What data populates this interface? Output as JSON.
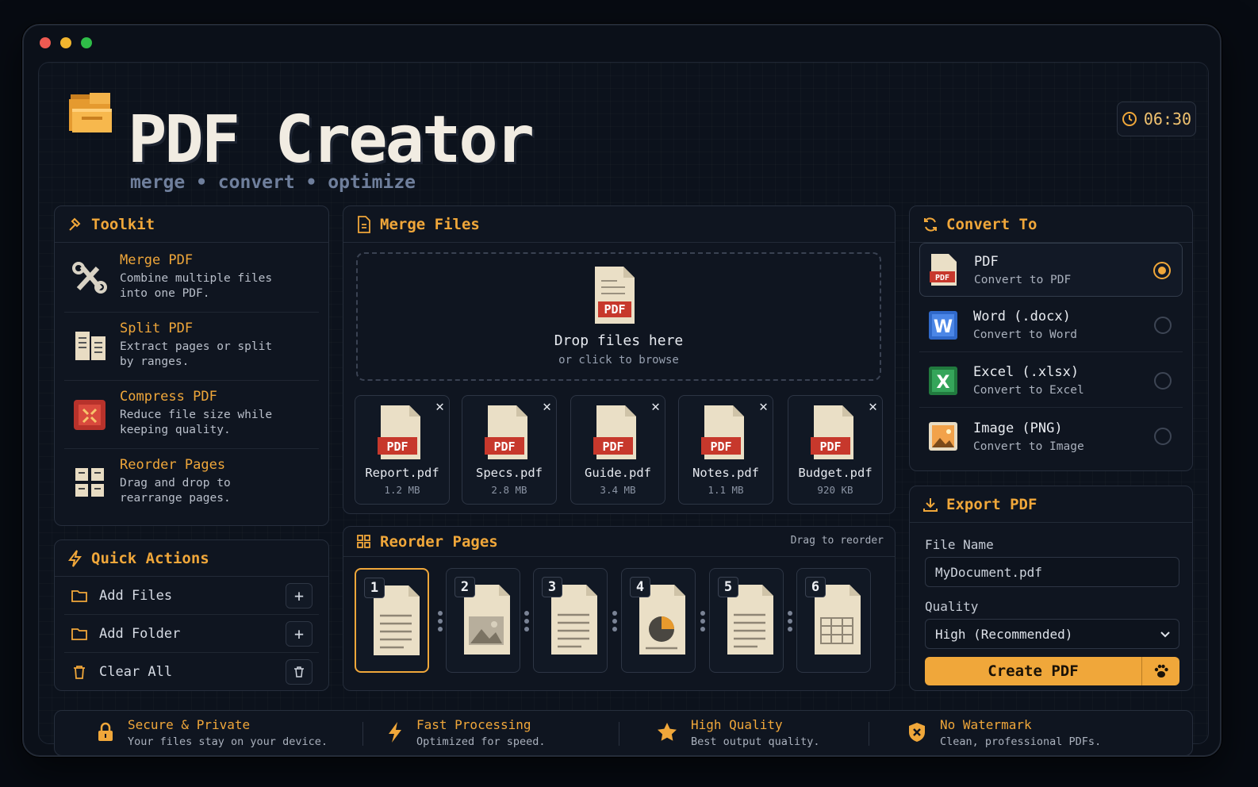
{
  "app": {
    "title": "PDF Creator",
    "subtitle": "merge • convert • optimize",
    "time": "06:30"
  },
  "colors": {
    "accent": "#f0a73a",
    "background": "#0b1019",
    "panel": "#0f1520"
  },
  "toolkit": {
    "title": "Toolkit",
    "items": [
      {
        "title": "Merge PDF",
        "desc": "Combine multiple files into one PDF.",
        "icon": "tools-icon"
      },
      {
        "title": "Split PDF",
        "desc": "Extract pages or split by ranges.",
        "icon": "split-document-icon"
      },
      {
        "title": "Compress PDF",
        "desc": "Reduce file size while keeping quality.",
        "icon": "compress-icon"
      },
      {
        "title": "Reorder Pages",
        "desc": "Drag and drop to rearrange pages.",
        "icon": "grid-pages-icon"
      }
    ]
  },
  "quick_actions": {
    "title": "Quick Actions",
    "items": [
      {
        "label": "Add Files",
        "icon": "folder-icon",
        "action": "plus-icon"
      },
      {
        "label": "Add Folder",
        "icon": "folder-icon",
        "action": "plus-icon"
      },
      {
        "label": "Clear All",
        "icon": "trash-icon",
        "action": "trash-icon"
      }
    ]
  },
  "merge": {
    "title": "Merge Files",
    "drop_title": "Drop files here",
    "drop_sub": "or click to browse",
    "pdf_badge": "PDF",
    "files": [
      {
        "name": "Report.pdf",
        "size": "1.2 MB"
      },
      {
        "name": "Specs.pdf",
        "size": "2.8 MB"
      },
      {
        "name": "Guide.pdf",
        "size": "3.4 MB"
      },
      {
        "name": "Notes.pdf",
        "size": "1.1 MB"
      },
      {
        "name": "Budget.pdf",
        "size": "920 KB"
      }
    ]
  },
  "reorder": {
    "title": "Reorder Pages",
    "hint": "Drag to reorder",
    "pages": [
      {
        "num": "1",
        "kind": "text"
      },
      {
        "num": "2",
        "kind": "image"
      },
      {
        "num": "3",
        "kind": "text"
      },
      {
        "num": "4",
        "kind": "chart"
      },
      {
        "num": "5",
        "kind": "text"
      },
      {
        "num": "6",
        "kind": "table"
      }
    ]
  },
  "convert": {
    "title": "Convert To",
    "options": [
      {
        "title": "PDF",
        "sub": "Convert to PDF",
        "selected": true,
        "icon": "pdf-file-icon",
        "badge": "PDF"
      },
      {
        "title": "Word (.docx)",
        "sub": "Convert to Word",
        "selected": false,
        "icon": "word-icon",
        "badge": "W"
      },
      {
        "title": "Excel (.xlsx)",
        "sub": "Convert to Excel",
        "selected": false,
        "icon": "excel-icon",
        "badge": "X"
      },
      {
        "title": "Image (PNG)",
        "sub": "Convert to Image",
        "selected": false,
        "icon": "image-icon"
      }
    ]
  },
  "export": {
    "title": "Export PDF",
    "file_name_label": "File Name",
    "file_name_value": "MyDocument.pdf",
    "quality_label": "Quality",
    "quality_value": "High (Recommended)",
    "create_label": "Create PDF"
  },
  "features": [
    {
      "title": "Secure & Private",
      "desc": "Your files stay on your device.",
      "icon": "lock-icon"
    },
    {
      "title": "Fast Processing",
      "desc": "Optimized for speed.",
      "icon": "lightning-icon"
    },
    {
      "title": "High Quality",
      "desc": "Best output quality.",
      "icon": "star-icon"
    },
    {
      "title": "No Watermark",
      "desc": "Clean, professional PDFs.",
      "icon": "shield-x-icon"
    }
  ]
}
